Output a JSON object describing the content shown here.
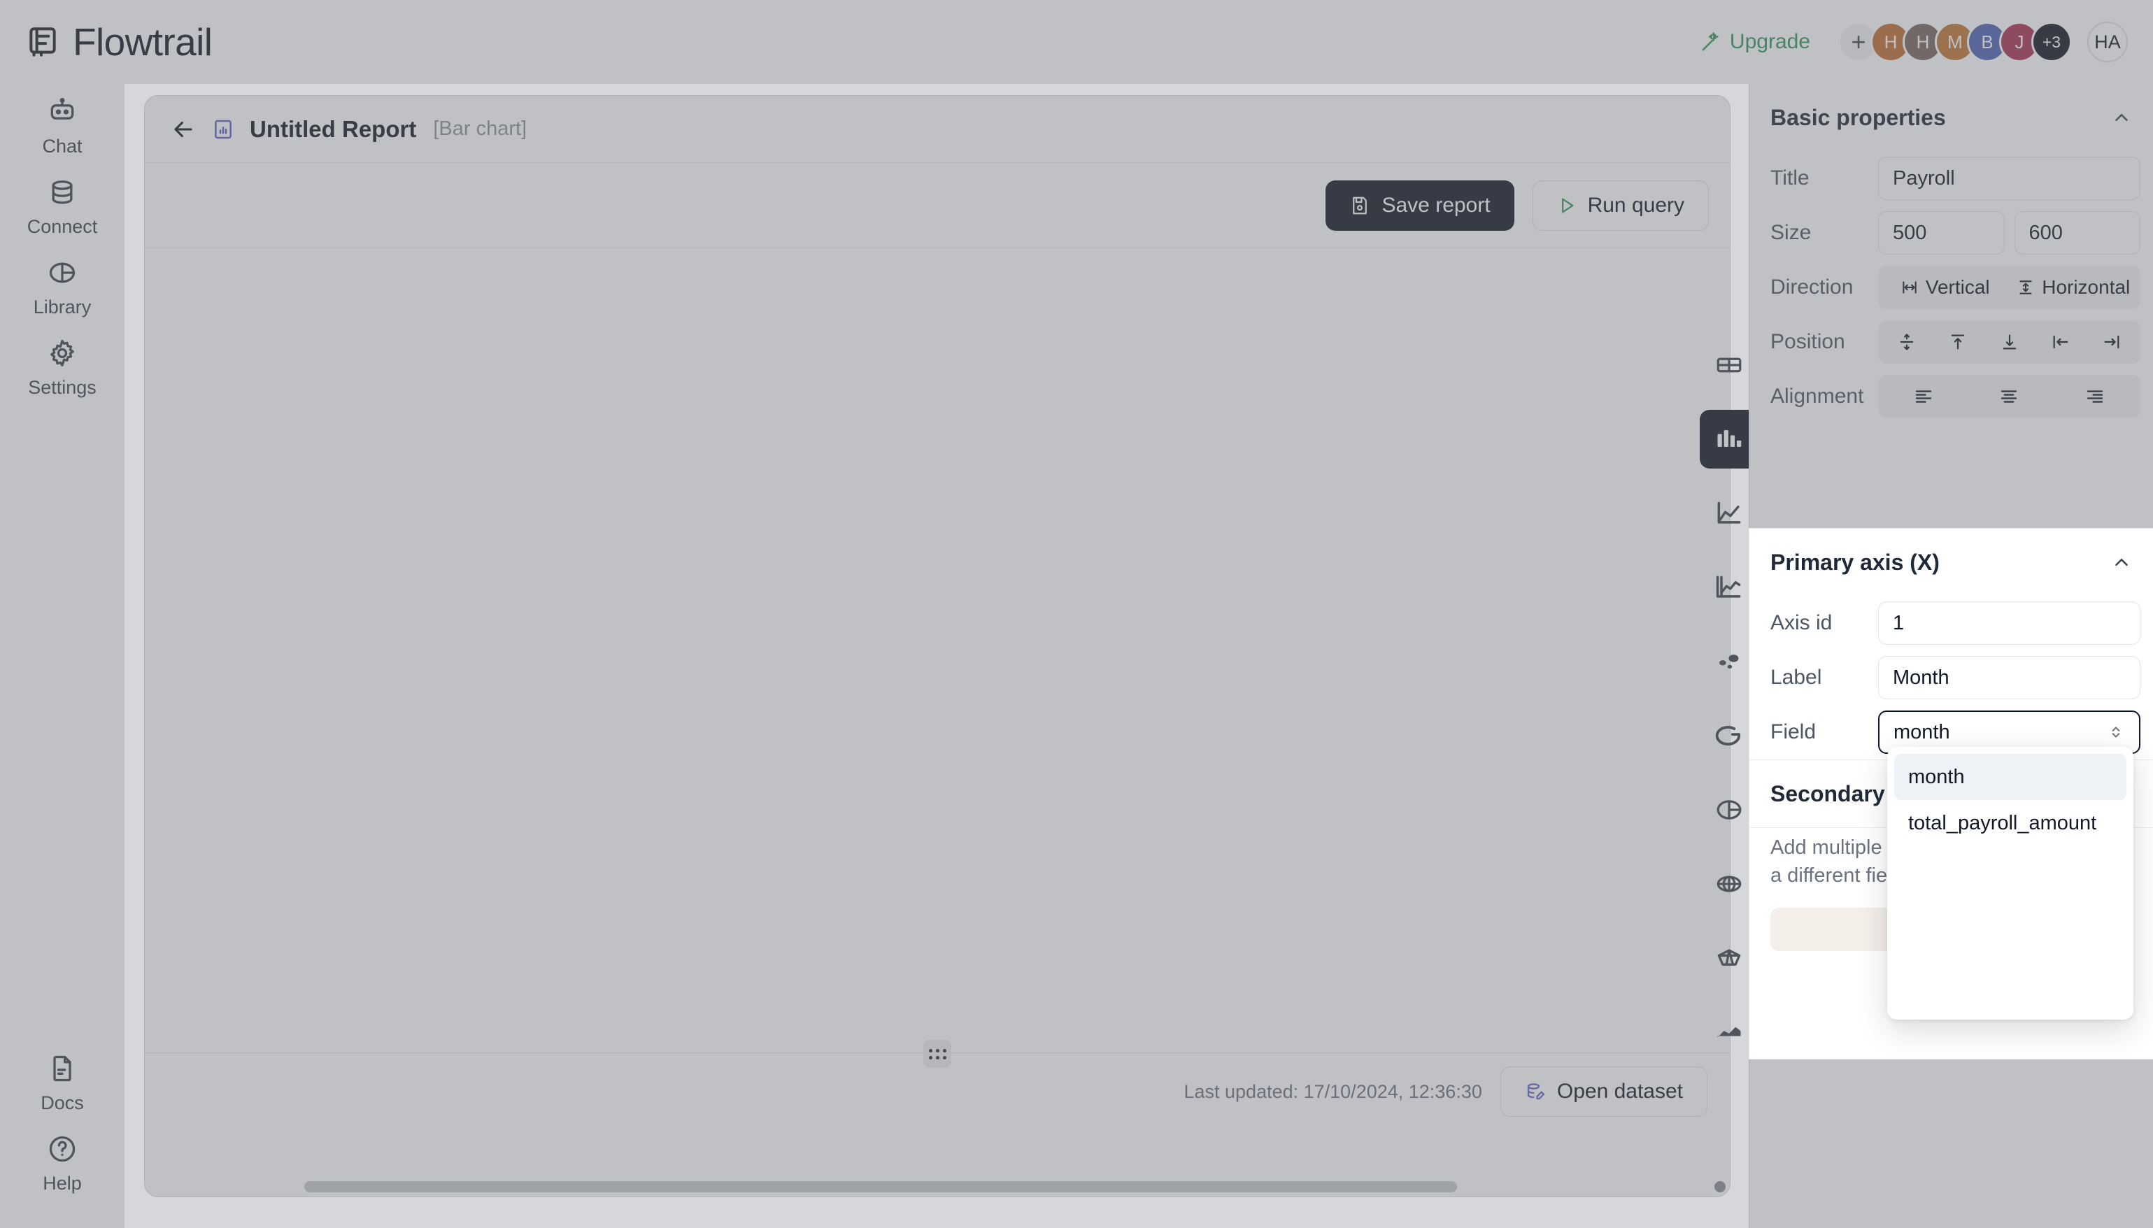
{
  "app": {
    "brand": "Flowtrail",
    "brand_icon": "flowtrail-logo-icon"
  },
  "topbar": {
    "upgrade_label": "Upgrade",
    "upgrade_icon": "magic-wand-icon",
    "upgrade_color": "#1a9c4e",
    "add_member_label": "+",
    "avatars": [
      {
        "initial": "H",
        "color": "#d2691e"
      },
      {
        "initial": "H",
        "color": "#7a645c"
      },
      {
        "initial": "M",
        "color": "#d2721a"
      },
      {
        "initial": "B",
        "color": "#4a62c9"
      },
      {
        "initial": "J",
        "color": "#c22a52"
      },
      {
        "initial": "+3",
        "color": "#0f172a"
      }
    ],
    "current_user_initials": "HA"
  },
  "sidebar": {
    "items": [
      {
        "label": "Chat",
        "icon": "robot-icon"
      },
      {
        "label": "Connect",
        "icon": "database-icon"
      },
      {
        "label": "Library",
        "icon": "pie-chart-icon"
      },
      {
        "label": "Settings",
        "icon": "gear-icon"
      }
    ],
    "bottom_items": [
      {
        "label": "Docs",
        "icon": "document-icon"
      },
      {
        "label": "Help",
        "icon": "question-circle-icon"
      }
    ]
  },
  "report": {
    "back_icon": "arrow-left-icon",
    "type_icon": "bar-chart-icon",
    "title": "Untitled Report",
    "subtitle": "[Bar chart]",
    "toolbar": {
      "save_label": "Save report",
      "save_icon": "floppy-disk-icon",
      "run_label": "Run query",
      "run_icon": "play-triangle-icon",
      "run_icon_color": "#22a152"
    },
    "status": {
      "last_updated": "Last updated: 17/10/2024, 12:36:30",
      "open_dataset_label": "Open dataset",
      "open_dataset_icon": "database-edit-icon"
    },
    "drag_handle_icon": "drag-dots-icon"
  },
  "chart_types": [
    {
      "name": "table-chart-icon",
      "active": false
    },
    {
      "name": "bar-chart-icon",
      "active": true
    },
    {
      "name": "line-chart-icon",
      "active": false
    },
    {
      "name": "area-line-chart-icon",
      "active": false
    },
    {
      "name": "scatter-chart-icon",
      "active": false
    },
    {
      "name": "donut-chart-icon",
      "active": false
    },
    {
      "name": "pie-chart-icon",
      "active": false
    },
    {
      "name": "radar-chart-icon",
      "active": false
    },
    {
      "name": "polygon-chart-icon",
      "active": false
    },
    {
      "name": "area-chart-icon",
      "active": false
    }
  ],
  "basic_properties": {
    "header": "Basic properties",
    "collapse_icon": "chevron-up-icon",
    "title_label": "Title",
    "title_value": "Payroll",
    "size_label": "Size",
    "size_width": "500",
    "size_height": "600",
    "direction_label": "Direction",
    "direction_vertical": "Vertical",
    "direction_vertical_icon": "horizontal-arrows-icon",
    "direction_horizontal": "Horizontal",
    "direction_horizontal_icon": "vertical-arrows-icon",
    "position_label": "Position",
    "position_options": [
      "align-center-vertical-icon",
      "align-top-icon",
      "align-bottom-icon",
      "align-left-icon",
      "align-right-icon"
    ],
    "alignment_label": "Alignment",
    "alignment_options": [
      "text-align-left-icon",
      "text-align-center-icon",
      "text-align-right-icon"
    ]
  },
  "primary_axis": {
    "header": "Primary axis (X)",
    "collapse_icon": "chevron-up-icon",
    "axis_id_label": "Axis id",
    "axis_id_value": "1",
    "label_label": "Label",
    "label_value": "Month",
    "field_label": "Field",
    "field_value": "month",
    "field_stepper_icon": "chevron-up-down-icon"
  },
  "secondary_axis": {
    "header": "Secondary axis (Y)",
    "description": "Add multiple axes. Each axis can have a different field and data source."
  },
  "field_dropdown": {
    "options": [
      {
        "label": "month",
        "selected": true
      },
      {
        "label": "total_payroll_amount",
        "selected": false
      }
    ]
  }
}
